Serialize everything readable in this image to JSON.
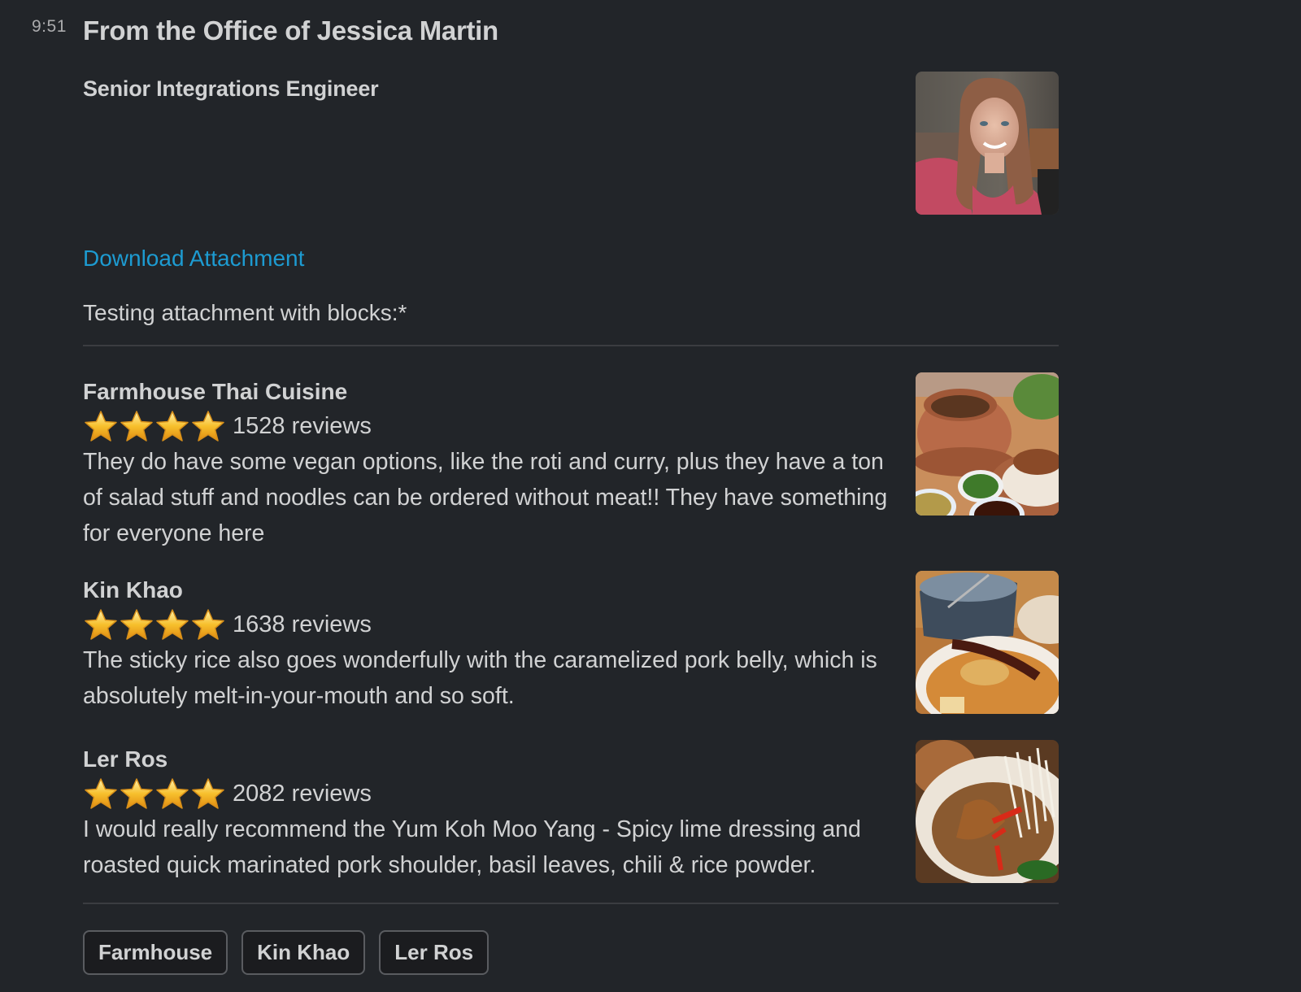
{
  "message": {
    "timestamp": "9:51",
    "title": "From the Office of Jessica Martin",
    "subtitle": "Senior Integrations Engineer",
    "profile_image_alt": "Photo of Jessica Martin",
    "download_link": "Download Attachment",
    "intro_text": "Testing attachment with blocks:*"
  },
  "restaurants": [
    {
      "name": "Farmhouse Thai Cuisine",
      "stars": 4,
      "reviews": "1528 reviews",
      "review_text": "They do have some vegan options, like the roti and curry, plus they have a ton of salad stuff and noodles can be ordered without meat!! They have something for everyone here",
      "image_alt": "Farmhouse Thai Cuisine food photo"
    },
    {
      "name": "Kin Khao",
      "stars": 4,
      "reviews": "1638 reviews",
      "review_text": "The sticky rice also goes wonderfully with the caramelized pork belly, which is absolutely melt-in-your-mouth and so soft.",
      "image_alt": "Kin Khao food photo"
    },
    {
      "name": "Ler Ros",
      "stars": 4,
      "reviews": "2082 reviews",
      "review_text": "I would really recommend the  Yum Koh Moo Yang - Spicy lime dressing and roasted quick marinated pork shoulder, basil leaves, chili & rice powder.",
      "image_alt": "Ler Ros food photo"
    }
  ],
  "actions": {
    "buttons": [
      {
        "label": "Farmhouse"
      },
      {
        "label": "Kin Khao"
      },
      {
        "label": "Ler Ros"
      }
    ]
  },
  "colors": {
    "background": "#222529",
    "text": "#d1d2d3",
    "link": "#1d9bd1",
    "timestamp": "#ababad",
    "star": "#f7c02d"
  }
}
